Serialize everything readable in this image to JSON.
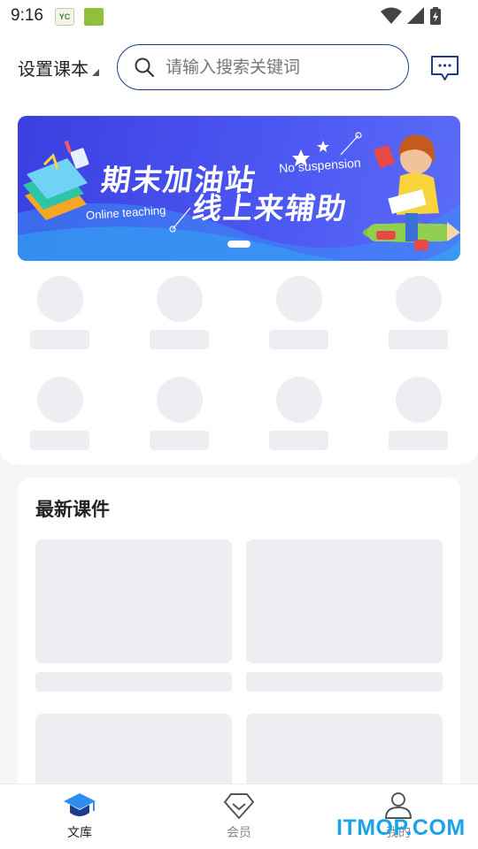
{
  "status_bar": {
    "time": "9:16",
    "app1_text": "YC",
    "icons": [
      "wifi-icon",
      "signal-icon",
      "battery-charging-icon"
    ]
  },
  "header": {
    "grade_selector": "设置课本",
    "search": {
      "placeholder": "请输入搜索关键词",
      "value": ""
    },
    "message_icon": "chat-bubble-icon"
  },
  "banner": {
    "title_line1": "期末加油站",
    "title_line2": "线上来辅助",
    "en_text1": "No suspension",
    "en_text2": "Online teaching",
    "active_slide": 1,
    "slide_count": 1
  },
  "category_grid": {
    "rows": 2,
    "columns": 4,
    "loading": true
  },
  "latest_courses": {
    "title": "最新课件",
    "loading": true,
    "placeholder_items": 4
  },
  "bottom_nav": {
    "items": [
      {
        "label": "文库",
        "icon": "graduation-cap-icon",
        "active": true
      },
      {
        "label": "会员",
        "icon": "diamond-icon",
        "active": false
      },
      {
        "label": "我的",
        "icon": "user-icon",
        "active": false
      }
    ],
    "active_color": "#1e3b8c",
    "inactive_color": "#888888"
  },
  "watermark": "ITMOP.COM",
  "colors": {
    "accent": "#1e3b8c",
    "banner": "#4b56f2",
    "placeholder": "#eceef1"
  }
}
